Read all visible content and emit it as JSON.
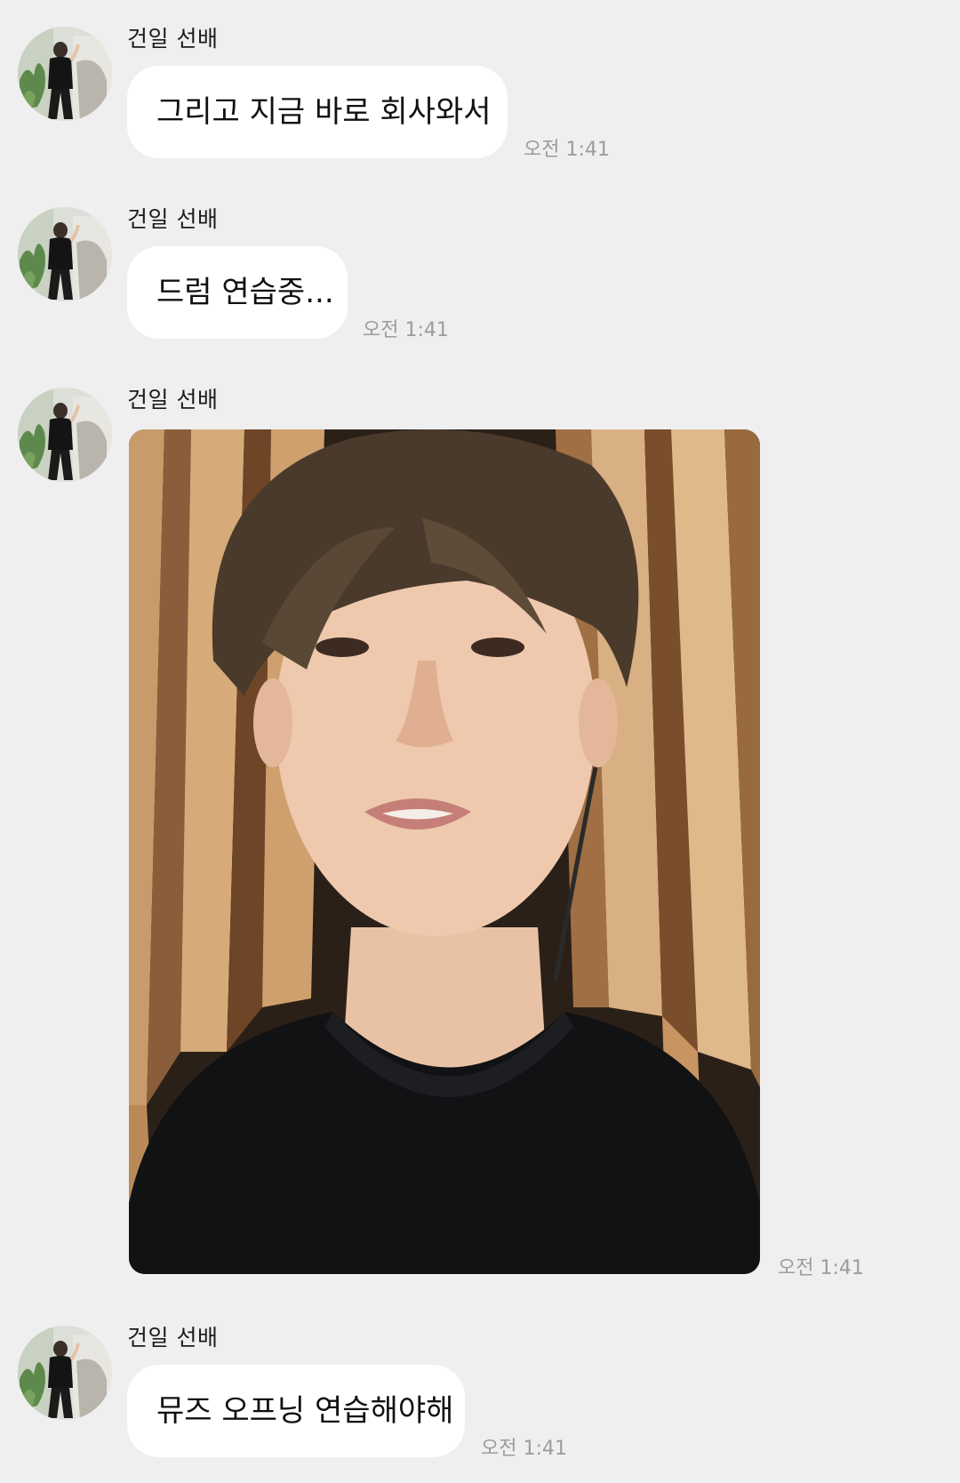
{
  "messages": [
    {
      "sender": "건일 선배",
      "text": "그리고 지금 바로 회사와서",
      "time": "오전 1:41"
    },
    {
      "sender": "건일 선배",
      "text": "드럼 연습중...",
      "time": "오전 1:41"
    },
    {
      "sender": "건일 선배",
      "image": "selfie-photo",
      "time": "오전 1:41"
    },
    {
      "sender": "건일 선배",
      "text": "뮤즈 오프닝 연습해야해",
      "time": "오전 1:41"
    }
  ]
}
